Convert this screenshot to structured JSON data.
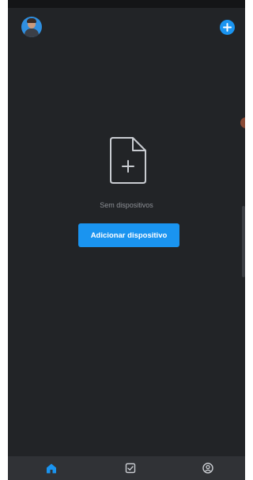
{
  "header": {
    "avatar_icon": "user-avatar",
    "add_icon": "plus-circle-icon"
  },
  "empty_state": {
    "icon": "file-add-icon",
    "label": "Sem dispositivos",
    "button_label": "Adicionar dispositivo"
  },
  "nav": {
    "items": [
      {
        "icon": "home-icon",
        "active": true
      },
      {
        "icon": "checkbox-icon",
        "active": false
      },
      {
        "icon": "user-circle-icon",
        "active": false
      }
    ]
  },
  "colors": {
    "background": "#222427",
    "accent": "#1a94f0",
    "nav_background": "#303236",
    "muted_text": "#8d9096"
  }
}
